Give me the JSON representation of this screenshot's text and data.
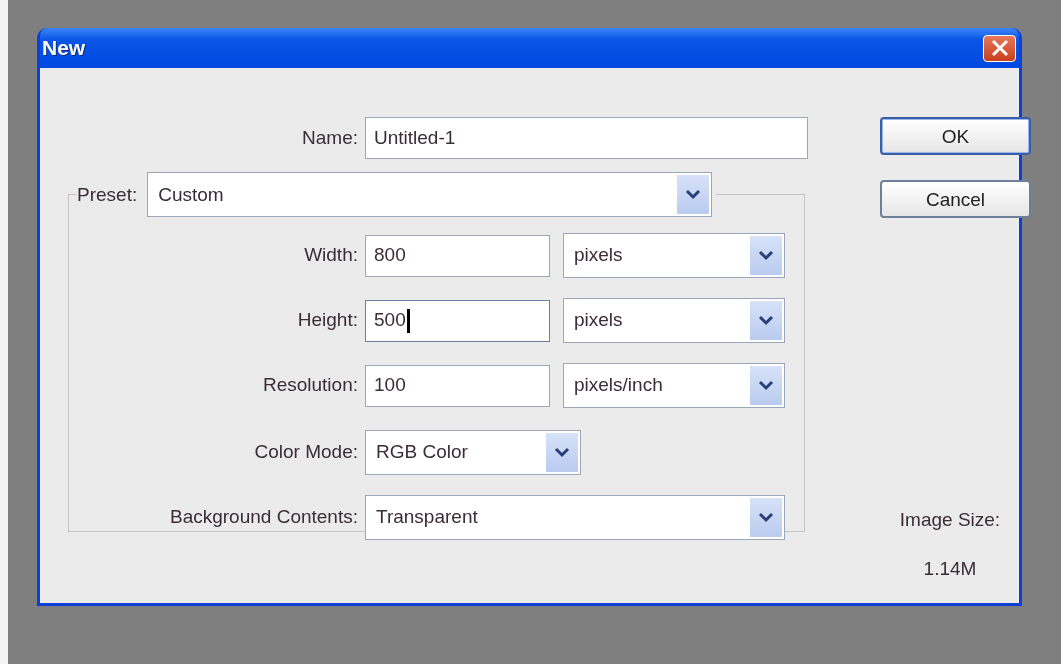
{
  "window": {
    "title": "New"
  },
  "name_field": {
    "label": "Name:",
    "value": "Untitled-1"
  },
  "preset": {
    "label": "Preset:",
    "value": "Custom"
  },
  "fields": [
    {
      "label": "Width:",
      "value": "800",
      "unit": "pixels",
      "focused": false
    },
    {
      "label": "Height:",
      "value": "500",
      "unit": "pixels",
      "focused": true
    },
    {
      "label": "Resolution:",
      "value": "100",
      "unit": "pixels/inch",
      "focused": false
    }
  ],
  "color_mode": {
    "label": "Color Mode:",
    "value": "RGB Color"
  },
  "background_contents": {
    "label": "Background Contents:",
    "value": "Transparent"
  },
  "buttons": [
    {
      "label": "OK",
      "default": true
    },
    {
      "label": "Cancel",
      "default": false
    }
  ],
  "image_size": {
    "label": "Image Size:",
    "value": "1.14M"
  }
}
